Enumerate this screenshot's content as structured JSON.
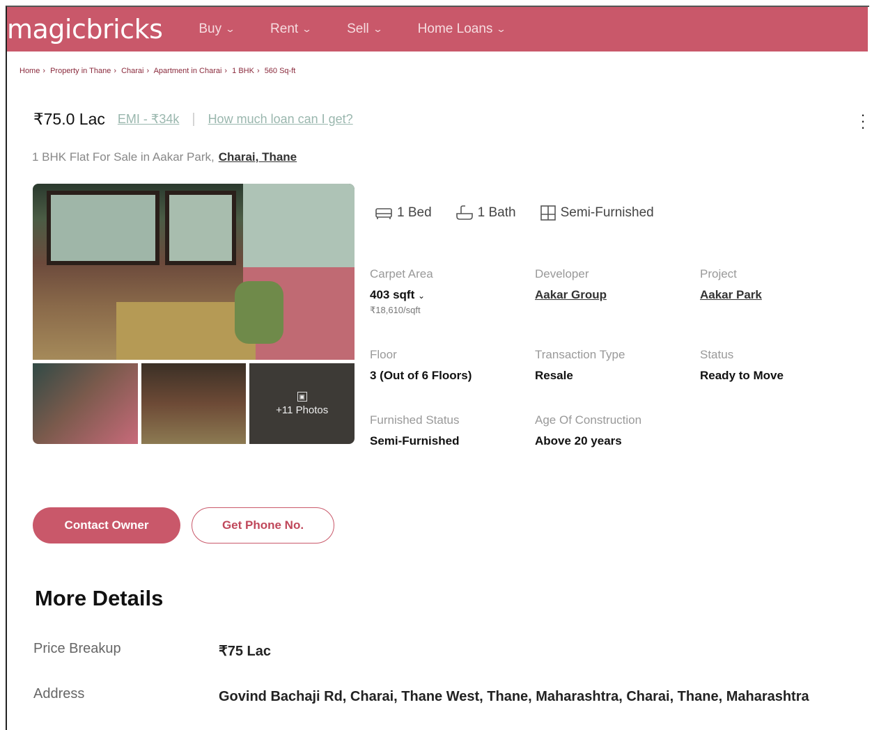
{
  "header": {
    "logo": "magicbricks",
    "nav": [
      {
        "label": "Buy"
      },
      {
        "label": "Rent"
      },
      {
        "label": "Sell"
      },
      {
        "label": "Home Loans"
      }
    ]
  },
  "breadcrumb": [
    "Home",
    "Property in Thane",
    "Charai",
    "Apartment in Charai",
    "1 BHK",
    "560 Sq-ft"
  ],
  "listing": {
    "price": "₹75.0 Lac",
    "emi": "EMI - ₹34k",
    "separator": "|",
    "loan_link": "How much loan can I get?",
    "subtitle": "1 BHK Flat For Sale in Aakar Park,",
    "location": "Charai, Thane",
    "photos_label": "+11 Photos"
  },
  "amenities": [
    {
      "icon": "bed-icon",
      "label": "1 Bed"
    },
    {
      "icon": "bath-icon",
      "label": "1 Bath"
    },
    {
      "icon": "furnishing-icon",
      "label": "Semi-Furnished"
    }
  ],
  "specs": {
    "carpet_area": {
      "label": "Carpet Area",
      "value": "403 sqft",
      "sub": "₹18,610/sqft"
    },
    "developer": {
      "label": "Developer",
      "value": "Aakar Group"
    },
    "project": {
      "label": "Project",
      "value": "Aakar Park"
    },
    "floor": {
      "label": "Floor",
      "value": "3 (Out of 6 Floors)"
    },
    "transaction": {
      "label": "Transaction Type",
      "value": "Resale"
    },
    "status": {
      "label": "Status",
      "value": "Ready to Move"
    },
    "furnished": {
      "label": "Furnished Status",
      "value": "Semi-Furnished"
    },
    "age": {
      "label": "Age Of Construction",
      "value": "Above 20 years"
    }
  },
  "actions": {
    "contact_owner": "Contact Owner",
    "get_phone": "Get Phone No."
  },
  "more_details": {
    "title": "More Details",
    "price_breakup_label": "Price Breakup",
    "price_breakup_value": "₹75 Lac",
    "address_label": "Address",
    "address_value": "Govind Bachaji Rd, Charai, Thane West, Thane, Maharashtra, Charai, Thane, Maharashtra"
  },
  "colors": {
    "brand": "#c9586a"
  }
}
